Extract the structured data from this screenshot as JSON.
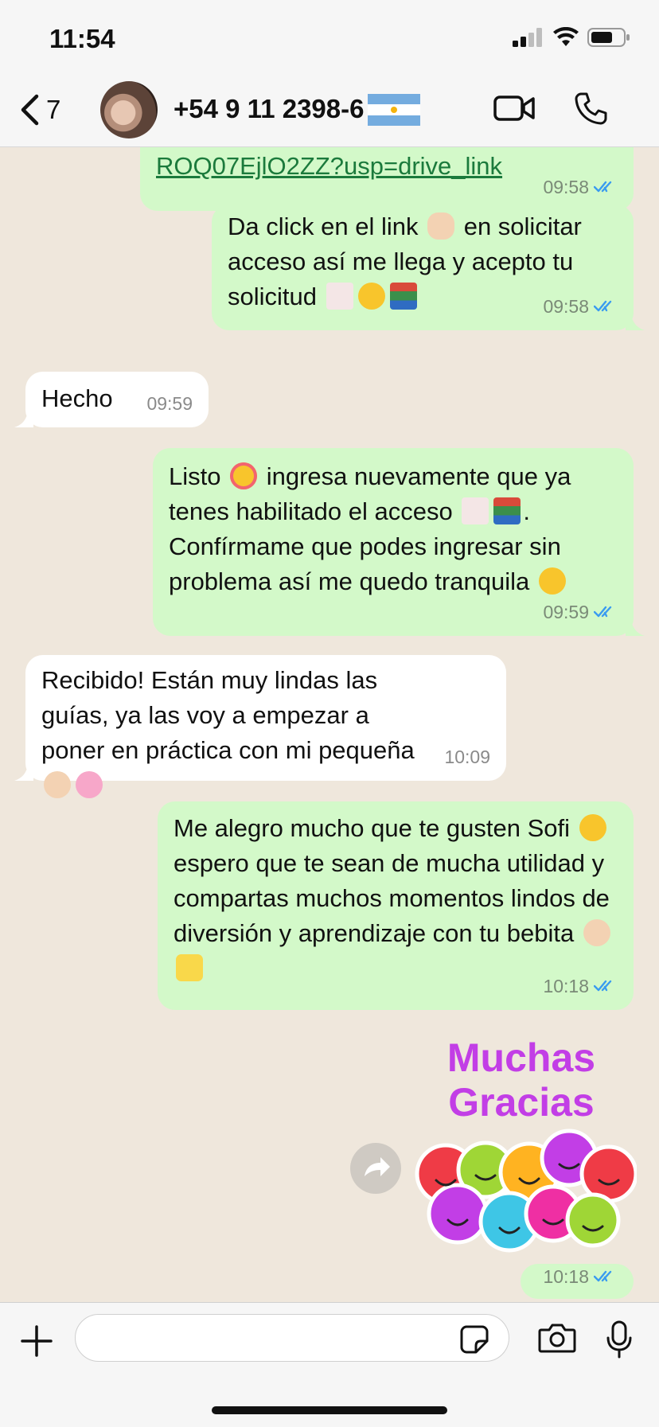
{
  "status_bar": {
    "time": "11:54"
  },
  "header": {
    "back_count": "7",
    "contact_name": "+54 9 11 2398-6"
  },
  "messages": [
    {
      "text": "ROQ07EjlO2ZZ?usp=drive_link",
      "time": "09:58"
    },
    {
      "text_a": "Da click en el link ",
      "text_b": " en solicitar acceso así me llega y acepto tu solicitud ",
      "time": "09:58"
    },
    {
      "text": "Hecho",
      "time": "09:59"
    },
    {
      "text_a": "Listo ",
      "text_b": " ingresa nuevamente que ya tenes habilitado el acceso ",
      "text_c": ". Confírmame que podes ingresar sin problema así me quedo tranquila ",
      "time": "09:59"
    },
    {
      "text": "Recibido! Están muy lindas las guías, ya las voy a empezar a poner en práctica con mi pequeña ",
      "time": "10:09"
    },
    {
      "text_a": "Me alegro mucho que te gusten Sofi ",
      "text_b": " espero que te sean de mucha utilidad y compartas muchos momentos lindos de diversión y aprendizaje con tu bebita ",
      "time": "10:18"
    },
    {
      "time": "10:18"
    }
  ],
  "sticker": {
    "line1": "Muchas",
    "line2": "Gracias"
  },
  "input": {
    "placeholder": ""
  },
  "colors": {
    "outgoing": "#d3f9c9",
    "incoming": "#ffffff",
    "read_ticks": "#3a9bf0",
    "sticker_text": "#c23ee6"
  }
}
